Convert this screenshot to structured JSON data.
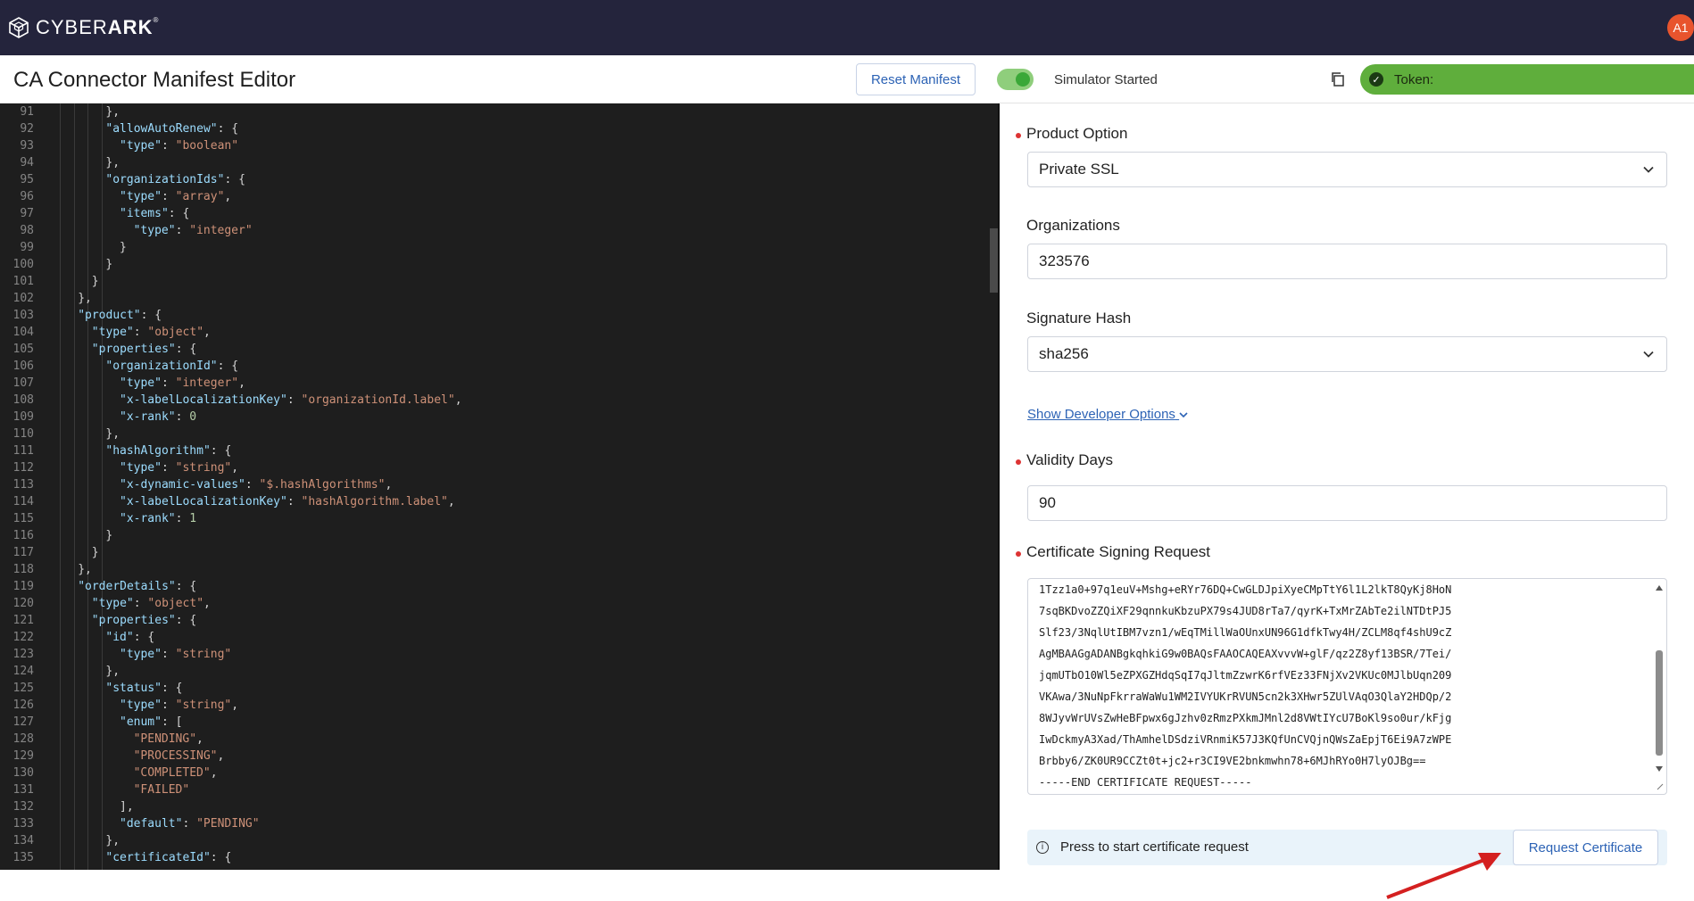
{
  "brand": {
    "logo_name": "CYBER",
    "logo_bold": "ARK",
    "mark": "®"
  },
  "user": {
    "initials": "A1"
  },
  "header": {
    "title": "CA Connector Manifest Editor",
    "reset_label": "Reset Manifest",
    "simulator_status": "Simulator Started",
    "token_label": "Token:"
  },
  "editor": {
    "lines": [
      {
        "n": "91",
        "i": 8,
        "t": "},"
      },
      {
        "n": "92",
        "i": 8,
        "t": "\"allowAutoRenew\": {"
      },
      {
        "n": "93",
        "i": 10,
        "t": "\"type\": \"boolean\""
      },
      {
        "n": "94",
        "i": 8,
        "t": "},"
      },
      {
        "n": "95",
        "i": 8,
        "t": "\"organizationIds\": {"
      },
      {
        "n": "96",
        "i": 10,
        "t": "\"type\": \"array\","
      },
      {
        "n": "97",
        "i": 10,
        "t": "\"items\": {"
      },
      {
        "n": "98",
        "i": 12,
        "t": "\"type\": \"integer\""
      },
      {
        "n": "99",
        "i": 10,
        "t": "}"
      },
      {
        "n": "100",
        "i": 8,
        "t": "}"
      },
      {
        "n": "101",
        "i": 6,
        "t": "}"
      },
      {
        "n": "102",
        "i": 4,
        "t": "},"
      },
      {
        "n": "103",
        "i": 4,
        "t": "\"product\": {"
      },
      {
        "n": "104",
        "i": 6,
        "t": "\"type\": \"object\","
      },
      {
        "n": "105",
        "i": 6,
        "t": "\"properties\": {"
      },
      {
        "n": "106",
        "i": 8,
        "t": "\"organizationId\": {"
      },
      {
        "n": "107",
        "i": 10,
        "t": "\"type\": \"integer\","
      },
      {
        "n": "108",
        "i": 10,
        "t": "\"x-labelLocalizationKey\": \"organizationId.label\","
      },
      {
        "n": "109",
        "i": 10,
        "t": "\"x-rank\": 0"
      },
      {
        "n": "110",
        "i": 8,
        "t": "},"
      },
      {
        "n": "111",
        "i": 8,
        "t": "\"hashAlgorithm\": {"
      },
      {
        "n": "112",
        "i": 10,
        "t": "\"type\": \"string\","
      },
      {
        "n": "113",
        "i": 10,
        "t": "\"x-dynamic-values\": \"$.hashAlgorithms\","
      },
      {
        "n": "114",
        "i": 10,
        "t": "\"x-labelLocalizationKey\": \"hashAlgorithm.label\","
      },
      {
        "n": "115",
        "i": 10,
        "t": "\"x-rank\": 1"
      },
      {
        "n": "116",
        "i": 8,
        "t": "}"
      },
      {
        "n": "117",
        "i": 6,
        "t": "}"
      },
      {
        "n": "118",
        "i": 4,
        "t": "},"
      },
      {
        "n": "119",
        "i": 4,
        "t": "\"orderDetails\": {"
      },
      {
        "n": "120",
        "i": 6,
        "t": "\"type\": \"object\","
      },
      {
        "n": "121",
        "i": 6,
        "t": "\"properties\": {"
      },
      {
        "n": "122",
        "i": 8,
        "t": "\"id\": {"
      },
      {
        "n": "123",
        "i": 10,
        "t": "\"type\": \"string\""
      },
      {
        "n": "124",
        "i": 8,
        "t": "},"
      },
      {
        "n": "125",
        "i": 8,
        "t": "\"status\": {"
      },
      {
        "n": "126",
        "i": 10,
        "t": "\"type\": \"string\","
      },
      {
        "n": "127",
        "i": 10,
        "t": "\"enum\": ["
      },
      {
        "n": "128",
        "i": 12,
        "t": "\"PENDING\","
      },
      {
        "n": "129",
        "i": 12,
        "t": "\"PROCESSING\","
      },
      {
        "n": "130",
        "i": 12,
        "t": "\"COMPLETED\","
      },
      {
        "n": "131",
        "i": 12,
        "t": "\"FAILED\""
      },
      {
        "n": "132",
        "i": 10,
        "t": "],"
      },
      {
        "n": "133",
        "i": 10,
        "t": "\"default\": \"PENDING\""
      },
      {
        "n": "134",
        "i": 8,
        "t": "},"
      },
      {
        "n": "135",
        "i": 8,
        "t": "\"certificateId\": {"
      }
    ]
  },
  "form": {
    "product_option": {
      "label": "Product Option",
      "value": "Private SSL"
    },
    "organizations": {
      "label": "Organizations",
      "value": "323576"
    },
    "signature_hash": {
      "label": "Signature Hash",
      "value": "sha256"
    },
    "dev_options_label": "Show Developer Options",
    "validity_days": {
      "label": "Validity Days",
      "value": "90"
    },
    "csr": {
      "label": "Certificate Signing Request",
      "lines": [
        "1Tzz1a0+97q1euV+Mshg+eRYr76DQ+CwGLDJpiXyeCMpTtY6l1L2lkT8QyKj8HoN",
        "7sqBKDvoZZQiXF29qnnkuKbzuPX79s4JUD8rTa7/qyrK+TxMrZAbTe2ilNTDtPJ5",
        "Slf23/3NqlUtIBM7vzn1/wEqTMillWaOUnxUN96G1dfkTwy4H/ZCLM8qf4shU9cZ",
        "AgMBAAGgADANBgkqhkiG9w0BAQsFAAOCAQEAXvvvW+glF/qz2Z8yf13BSR/7Tei/",
        "jqmUTbO10Wl5eZPXGZHdqSqI7qJltmZzwrK6rfVEz33FNjXv2VKUc0MJlbUqn209",
        "VKAwa/3NuNpFkrraWaWu1WM2IVYUKrRVUN5cn2k3XHwr5ZUlVAqO3QlaY2HDQp/2",
        "8WJyvWrUVsZwHeBFpwx6gJzhv0zRmzPXkmJMnl2d8VWtIYcU7BoKl9so0ur/kFjg",
        "IwDckmyA3Xad/ThAmhelDSdziVRnmiK57J3KQfUnCVQjnQWsZaEpjT6Ei9A7zWPE",
        "Brbby6/ZK0UR9CCZt0t+jc2+r3CI9VE2bnkmwhn78+6MJhRYo0H7lyOJBg==",
        "-----END CERTIFICATE REQUEST-----"
      ]
    },
    "info_text": "Press to start certificate request",
    "request_label": "Request Certificate"
  },
  "colors": {
    "topbar": "#24243c",
    "token_bg": "#5fae3c",
    "accent_blue": "#2d63b5",
    "required_dot": "#dd3333",
    "arrow": "#d42020"
  }
}
